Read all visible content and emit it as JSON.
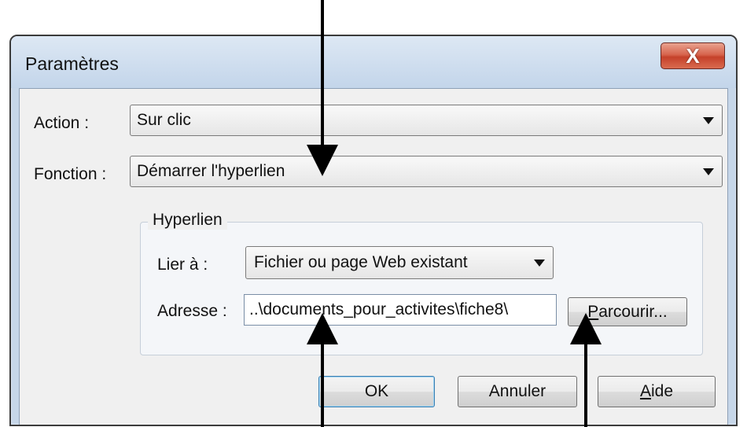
{
  "window": {
    "title": "Paramètres",
    "close_label": "X"
  },
  "action": {
    "label": "Action :",
    "value": "Sur clic"
  },
  "fonction": {
    "label": "Fonction :",
    "value": "Démarrer l'hyperlien"
  },
  "hyperlien": {
    "group_title": "Hyperlien",
    "lier_label": "Lier à :",
    "lier_value": "Fichier ou page Web existant",
    "adresse_label": "Adresse :",
    "adresse_value": "..\\documents_pour_activites\\fiche8\\",
    "parcourir_label": "Parcourir..."
  },
  "buttons": {
    "ok": "OK",
    "annuler": "Annuler",
    "aide": "Aide"
  },
  "colors": {
    "titlebar": "#c6d6e8",
    "close": "#d7654e",
    "client": "#f0f0f0",
    "arrows": "#000000"
  }
}
